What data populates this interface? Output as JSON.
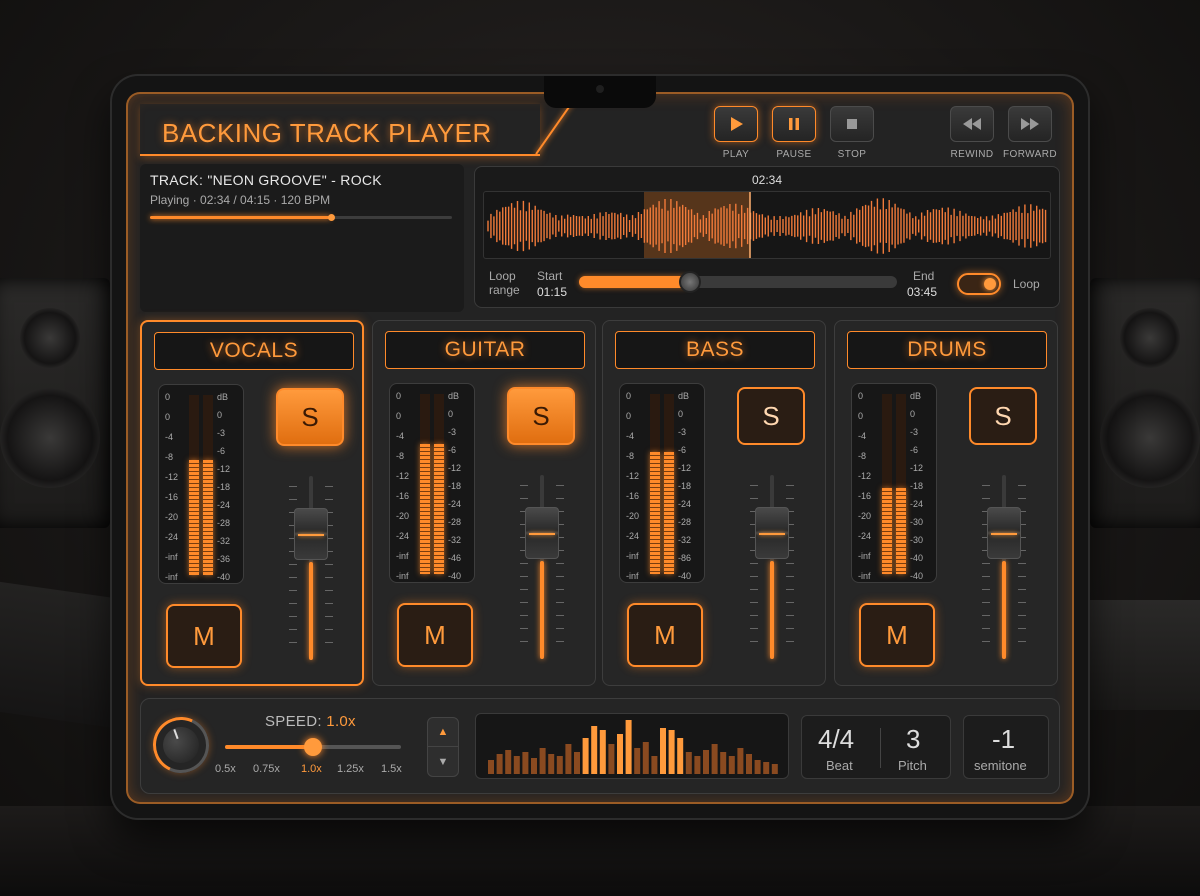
{
  "app": {
    "title": "BACKING TRACK PLAYER"
  },
  "transport": {
    "play": "PLAY",
    "pause": "PAUSE",
    "stop": "STOP",
    "rewind": "REWIND",
    "forward": "FORWARD"
  },
  "track": {
    "name": "TRACK: \"NEON GROOVE\" - ROCK",
    "status": "Playing · 02:34 / 04:15 · 120 BPM",
    "progress": 0.6
  },
  "waveform": {
    "time": "02:34",
    "loop_label": "Loop range",
    "start_label": "Start",
    "start_time": "01:15",
    "end_label": "End",
    "end_time": "03:45",
    "loop_toggle_label": "Loop",
    "loop_on": true,
    "loop_slider_value": 0.35
  },
  "meter_scale": {
    "left": [
      "0",
      "0",
      "-4",
      "-8",
      "-12",
      "-16",
      "-20",
      "-24",
      "-inf",
      "-inf"
    ],
    "right": [
      "dB",
      "0",
      "-3",
      "-6",
      "-12",
      "-18",
      "-24",
      "-28",
      "-32",
      "-36",
      "-40"
    ]
  },
  "channels": [
    {
      "name": "VOCALS",
      "solo_label": "S",
      "mute_label": "M",
      "solo_on": true,
      "selected": true,
      "level": 0.64,
      "scale_right": [
        "dB",
        "0",
        "-3",
        "-6",
        "-12",
        "-18",
        "-24",
        "-28",
        "-32",
        "-36",
        "-40"
      ]
    },
    {
      "name": "GUITAR",
      "solo_label": "S",
      "mute_label": "M",
      "solo_on": true,
      "selected": false,
      "level": 0.72,
      "scale_right": [
        "dB",
        "0",
        "-3",
        "-6",
        "-12",
        "-18",
        "-24",
        "-28",
        "-32",
        "-46",
        "-40"
      ]
    },
    {
      "name": "BASS",
      "solo_label": "S",
      "mute_label": "M",
      "solo_on": false,
      "selected": false,
      "level": 0.68,
      "scale_right": [
        "dB",
        "0",
        "-3",
        "-6",
        "-12",
        "-18",
        "-24",
        "-28",
        "-32",
        "-86",
        "-40"
      ]
    },
    {
      "name": "DRUMS",
      "solo_label": "S",
      "mute_label": "M",
      "solo_on": false,
      "selected": false,
      "level": 0.48,
      "scale_right": [
        "dB",
        "0",
        "-3",
        "-6",
        "-12",
        "-18",
        "-24",
        "-30",
        "-30",
        "-40",
        "-40"
      ]
    }
  ],
  "speed": {
    "label": "SPEED:",
    "value": "1.0x",
    "ticks": [
      "0.5x",
      "0.75x",
      "1.0x",
      "1.25x",
      "1.5x"
    ],
    "slider_value": 0.5
  },
  "beat": {
    "value": "4/4",
    "label": "Beat"
  },
  "pitch": {
    "value": "3",
    "label": "Pitch"
  },
  "semitone": {
    "value": "-1",
    "label": "semitone"
  },
  "colors": {
    "accent": "#ff8a2a",
    "panel": "#232323"
  }
}
